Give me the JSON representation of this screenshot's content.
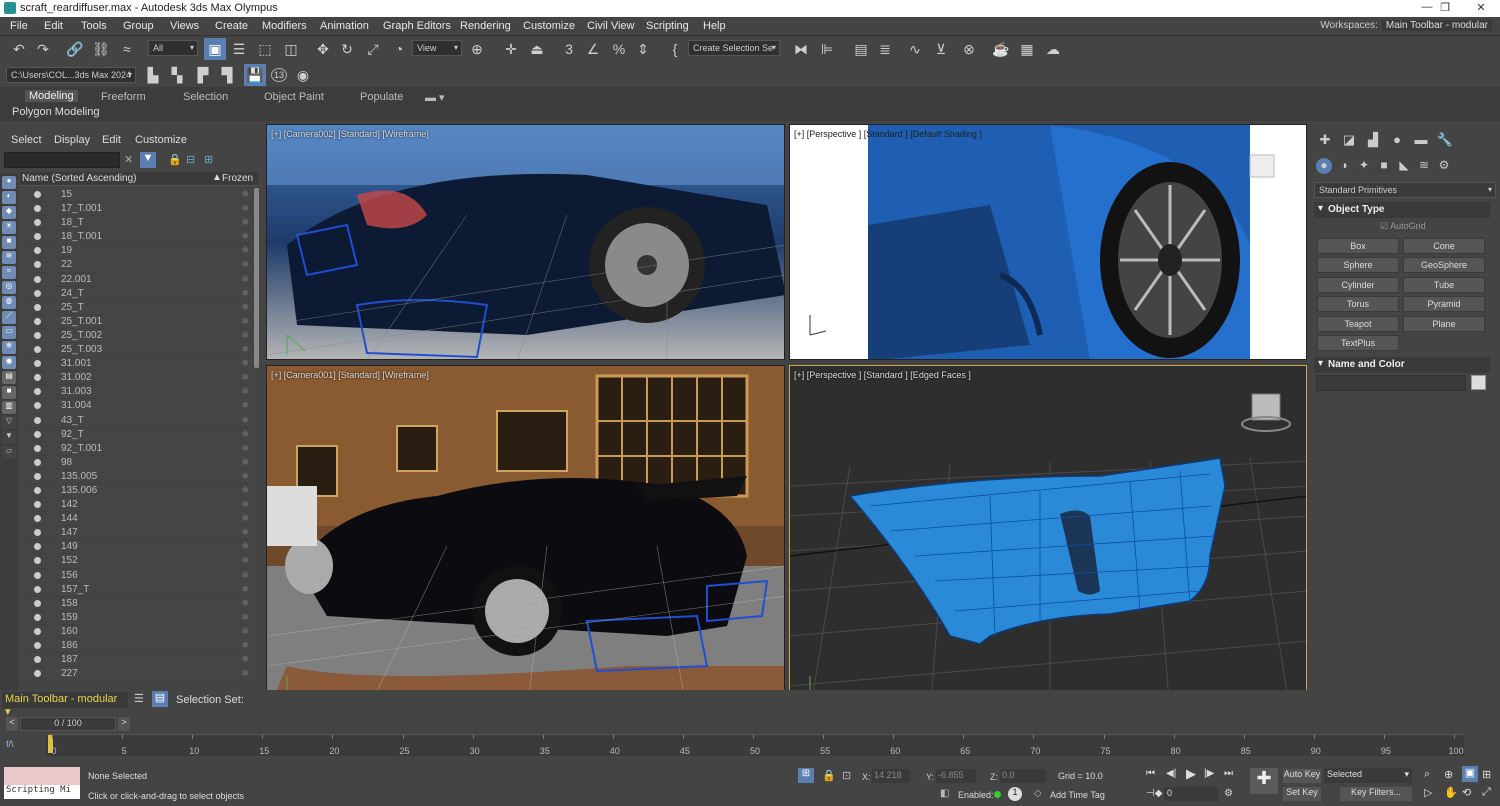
{
  "window": {
    "title": "scraft_reardiffuser.max - Autodesk 3ds Max Olympus"
  },
  "menu": [
    "File",
    "Edit",
    "Tools",
    "Group",
    "Views",
    "Create",
    "Modifiers",
    "Animation",
    "Graph Editors",
    "Rendering",
    "Customize",
    "Civil View",
    "Scripting",
    "Help"
  ],
  "workspace": {
    "label": "Workspaces:",
    "value": "Main Toolbar - modular"
  },
  "toolbar": {
    "filter": "All",
    "ref_coord": "View",
    "selection_set": "Create Selection Se",
    "path": "C:\\Users\\COL...3ds Max 2024",
    "badge": "13"
  },
  "ribbon": {
    "tabs": [
      "Modeling",
      "Freeform",
      "Selection",
      "Object Paint",
      "Populate"
    ],
    "sub": "Polygon Modeling"
  },
  "scene_explorer": {
    "menu": [
      "Select",
      "Display",
      "Edit",
      "Customize"
    ],
    "col_name": "Name (Sorted Ascending)",
    "col_frozen": "Frozen",
    "items": [
      "15",
      "17_T.001",
      "18_T",
      "18_T.001",
      "19",
      "22",
      "22.001",
      "24_T",
      "25_T",
      "25_T.001",
      "25_T.002",
      "25_T.003",
      "31.001",
      "31.002",
      "31.003",
      "31.004",
      "43_T",
      "92_T",
      "92_T.001",
      "98",
      "135.005",
      "135.006",
      "142",
      "144",
      "147",
      "149",
      "152",
      "156",
      "157_T",
      "158",
      "159",
      "160",
      "186",
      "187",
      "227"
    ]
  },
  "viewports": [
    {
      "label": "[+] [Camera002] [Standard] [Wireframe]"
    },
    {
      "label": "[+] [Perspective ] [Standard ] [Default Shading ]"
    },
    {
      "label": "[+] [Camera001] [Standard] [Wireframe]"
    },
    {
      "label": "[+] [Perspective ] [Standard ] [Edged Faces ]"
    }
  ],
  "command_panel": {
    "dropdown": "Standard Primitives",
    "object_type": "Object Type",
    "autogrid": "AutoGrid",
    "buttons": [
      "Box",
      "Cone",
      "Sphere",
      "GeoSphere",
      "Cylinder",
      "Tube",
      "Torus",
      "Pyramid",
      "Teapot",
      "Plane",
      "TextPlus"
    ],
    "name_and_color": "Name and Color"
  },
  "bottom": {
    "layer_toolbar": "Main Toolbar - modular",
    "selection_set": "Selection Set:",
    "frame": "0 / 100",
    "ticks": [
      "0",
      "5",
      "10",
      "15",
      "20",
      "25",
      "30",
      "35",
      "40",
      "45",
      "50",
      "55",
      "60",
      "65",
      "70",
      "75",
      "80",
      "85",
      "90",
      "95",
      "100"
    ],
    "maxscript": "Scripting Mi",
    "status": "None Selected",
    "prompt": "Click or click-and-drag to select objects",
    "x_label": "X:",
    "x": "14.218",
    "y_label": "Y:",
    "y": "-6.855",
    "z_label": "Z:",
    "z": "0.0",
    "grid": "Grid = 10.0",
    "enabled": "Enabled:",
    "add_time_tag": "Add Time Tag",
    "auto_key": "Auto Key",
    "selected": "Selected",
    "set_key": "Set Key",
    "key_filters": "Key Filters...",
    "current_frame": "0",
    "timeline_icon": "f/\\"
  }
}
